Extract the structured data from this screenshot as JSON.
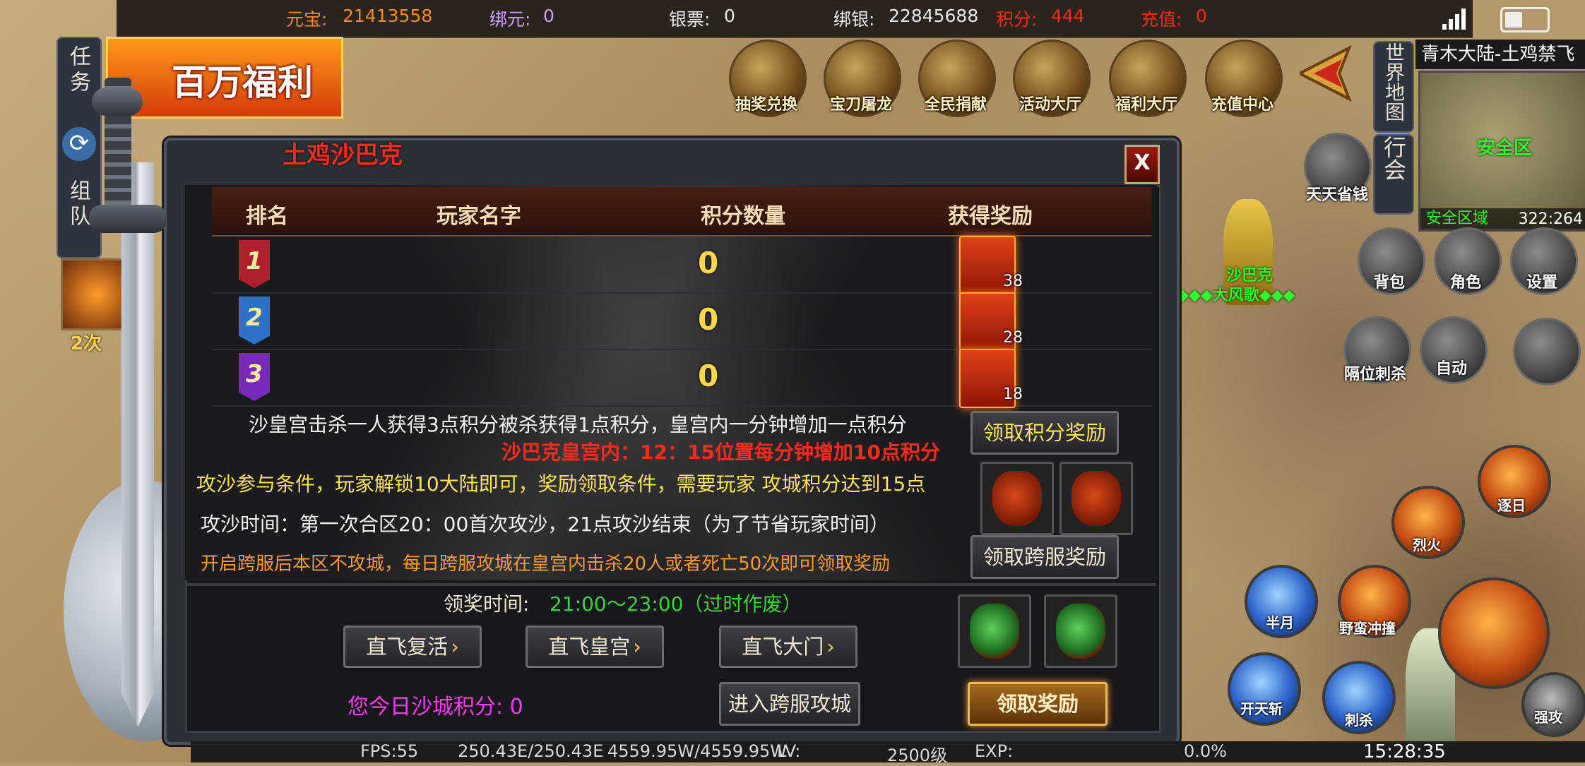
{
  "topbar": {
    "yuanbao_label": "元宝:",
    "yuanbao_value": "21413558",
    "bangyuan_label": "绑元:",
    "bangyuan_value": "0",
    "yinpiao_label": "银票:",
    "yinpiao_value": "0",
    "bangyin_label": "绑银:",
    "bangyin_value": "22845688",
    "jifen_label": "积分:",
    "jifen_value": "444",
    "chongzhi_label": "充值:",
    "chongzhi_value": "0"
  },
  "left_menu": {
    "task": "任务",
    "team": "组队",
    "promo": "百万福利",
    "skill_count": "2次"
  },
  "event_icons": [
    "抽奖兑换",
    "宝刀屠龙",
    "全民捐献",
    "活动大厅",
    "福利大厅",
    "充值中心"
  ],
  "right_panel": {
    "map_title": "青木大陆-土鸡禁飞",
    "world_map": "世界地图",
    "guild": "行会",
    "daily": "天天省钱",
    "safe_zone": "安全区",
    "zone_label": "安全区域",
    "coords": "322:264",
    "bag": "背包",
    "role": "角色",
    "settings": "设置",
    "auto": "自动",
    "separate": "隔位刺杀",
    "strengthen": "强攻",
    "player_guild": "沙巴克",
    "player_name": "大风歌"
  },
  "skills": [
    "逐日",
    "烈火",
    "半月",
    "野蛮冲撞",
    "开天斩",
    "刺杀"
  ],
  "dialog": {
    "title": "土鸡沙巴克",
    "close": "X",
    "headers": [
      "排名",
      "玩家名字",
      "积分数量",
      "获得奖励"
    ],
    "rows": [
      {
        "rank": "1",
        "name": "",
        "score": "0",
        "reward_count": "38"
      },
      {
        "rank": "2",
        "name": "",
        "score": "0",
        "reward_count": "28"
      },
      {
        "rank": "3",
        "name": "",
        "score": "0",
        "reward_count": "18"
      }
    ],
    "info1": "沙皇宫击杀一人获得3点积分被杀获得1点积分，皇宫内一分钟增加一点积分",
    "info2": "沙巴克皇宫内：12：15位置每分钟增加10点积分",
    "info3": "攻沙参与条件，玩家解锁10大陆即可，奖励领取条件，需要玩家 攻城积分达到15点",
    "info4": "攻沙时间：第一次合区20：00首次攻沙，21点攻沙结束（为了节省玩家时间）",
    "info5": "开启跨服后本区不攻城，每日跨服攻城在皇宫内击杀20人或者死亡50次即可领取奖励",
    "claim_points": "领取积分奖励",
    "claim_cross": "领取跨服奖励",
    "reward_time_label": "领奖时间:",
    "reward_time_value": "21:00～23:00（过时作废）",
    "fly_revive": "直飞复活",
    "fly_palace": "直飞皇宫",
    "fly_gate": "直飞大门",
    "today_score": "您今日沙城积分: 0",
    "enter_cross": "进入跨服攻城",
    "claim_reward": "领取奖励"
  },
  "bottombar": {
    "fps": "FPS:55",
    "hp": "250.43E/250.43E",
    "mp": "4559.95W/4559.95W",
    "lv_label": "LV:",
    "lv_value": "2500级",
    "exp_label": "EXP:",
    "exp_value": "0.0%",
    "time": "15:28:35"
  },
  "colors": {
    "orange": "#ff8a1a",
    "purple": "#c9a0ff",
    "white": "#e8e8e8",
    "red": "#ff2a1a",
    "yellow": "#ffe25a",
    "green": "#35d635",
    "magenta": "#ff3af0",
    "flag1": "#b0202a",
    "flag2": "#2a73c8",
    "flag3": "#7a2ab8"
  }
}
